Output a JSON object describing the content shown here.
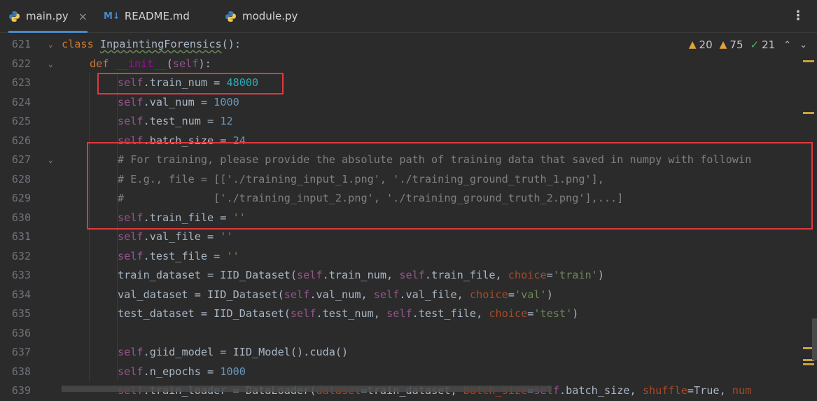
{
  "tabs": [
    {
      "label": "main.py",
      "icon": "python-icon",
      "active": true,
      "closable": true
    },
    {
      "label": "README.md",
      "icon": "markdown-icon",
      "icon_text": "M↓",
      "active": false
    },
    {
      "label": "module.py",
      "icon": "python-icon",
      "active": false
    }
  ],
  "tab_close_glyph": "×",
  "menu_glyph": "⋮",
  "inspections": {
    "warnings_weak": "20",
    "warnings": "75",
    "ok": "21"
  },
  "line_numbers": [
    "621",
    "622",
    "623",
    "624",
    "625",
    "626",
    "627",
    "628",
    "629",
    "630",
    "631",
    "632",
    "633",
    "634",
    "635",
    "636",
    "637",
    "638",
    "639"
  ],
  "code": {
    "l621": {
      "kw": "class ",
      "name": "InpaintingForensics",
      "rest": "():"
    },
    "l622": {
      "kw": "def ",
      "name": "__init__",
      "p1": "(",
      "self": "self",
      "p2": "):"
    },
    "l623": {
      "self": "self",
      ".attr": ".train_num = ",
      "val": "48000"
    },
    "l624": {
      "self": "self",
      "attr": ".val_num = ",
      "val": "1000"
    },
    "l625": {
      "self": "self",
      "attr": ".test_num = ",
      "val": "12"
    },
    "l626": {
      "self": "self",
      "attr": ".batch_size = ",
      "val": "24"
    },
    "l627": "# For training, please provide the absolute path of training data that saved in numpy with followin",
    "l628": "# E.g., file = [['./training_input_1.png', './training_ground_truth_1.png'],",
    "l629": "#              ['./training_input_2.png', './training_ground_truth_2.png'],...]",
    "l630": {
      "self": "self",
      "attr": ".train_file = ",
      "val": "''"
    },
    "l631": {
      "self": "self",
      "attr": ".val_file = ",
      "val": "''"
    },
    "l632": {
      "self": "self",
      "attr": ".test_file = ",
      "val": "''"
    },
    "l633": {
      "a": "train_dataset = IID_Dataset(",
      "self1": "self",
      ".b": ".train_num, ",
      "self2": "self",
      "c": ".train_file, ",
      "kw": "choice",
      "eq": "=",
      "s": "'train'",
      "end": ")"
    },
    "l634": {
      "a": "val_dataset = IID_Dataset(",
      "self1": "self",
      "b": ".val_num, ",
      "self2": "self",
      "c": ".val_file, ",
      "kw": "choice",
      "eq": "=",
      "s": "'val'",
      "end": ")"
    },
    "l635": {
      "a": "test_dataset = IID_Dataset(",
      "self1": "self",
      "b": ".test_num, ",
      "self2": "self",
      "c": ".test_file, ",
      "kw": "choice",
      "eq": "=",
      "s": "'test'",
      "end": ")"
    },
    "l637": {
      "self": "self",
      "attr": ".giid_model = IID_Model().cuda()"
    },
    "l638": {
      "self": "self",
      "attr": ".n_epochs = ",
      "val": "1000"
    },
    "l639": {
      "self": "self",
      "a": ".train_loader = DataLoader(",
      "k1": "dataset",
      "b": "=train_dataset, ",
      "k2": "batch_size",
      "c": "=",
      "self2": "self",
      "d": ".batch_size, ",
      "k3": "shuffle",
      "e": "=True, ",
      "k4": "num"
    }
  },
  "colors": {
    "highlight_box": "#e0383e",
    "keyword": "#cc7832",
    "self": "#94558d",
    "number": "#6897bb",
    "comment": "#808080",
    "string": "#6a8759"
  }
}
